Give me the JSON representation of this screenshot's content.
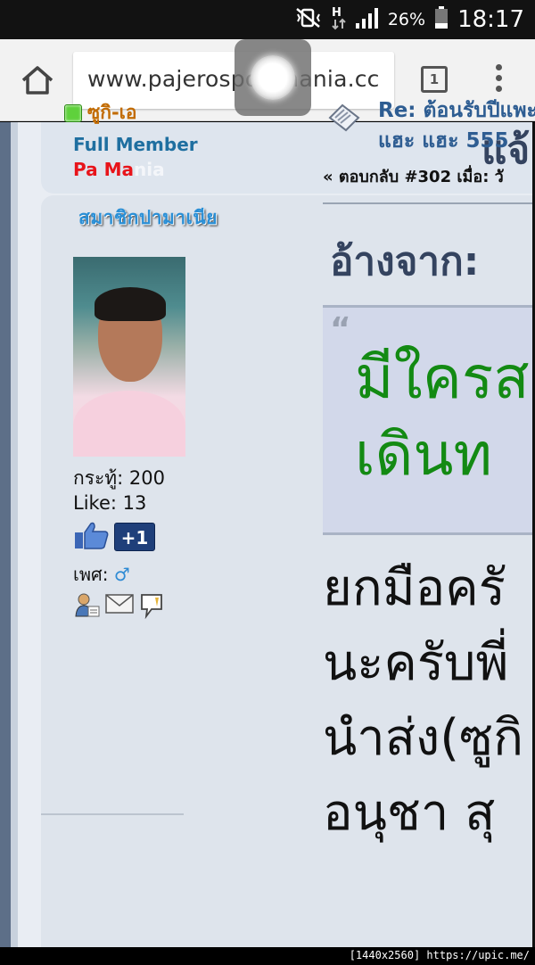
{
  "status_bar": {
    "battery": "26%",
    "time": "18:17",
    "network": "H"
  },
  "browser": {
    "url": "www.pajerosportmania.cc",
    "tab_count": "1"
  },
  "page": {
    "prev_post_fragment": "แจ้",
    "poster": {
      "name": "ซูกิ-เอ",
      "rank": "Full Member",
      "group_visible": "Pa Ma",
      "group_faded": "nia",
      "member_badge": "สมาชิกปามาเนีย",
      "posts_line": "กระทู้: 200",
      "likes_line": "Like: 13",
      "plus_one": "+1",
      "gender_label": "เพศ:",
      "gender_symbol": "♂"
    },
    "post": {
      "subject_line1": "Re: ต้อนรับปีแพะ",
      "subject_line2": "แฮะ แฮะ 555",
      "reply_line": "« ตอบกลับ #302 เมื่อ: วั",
      "quote_header": "อ้างจาก: ",
      "quote_mark": "“",
      "quote_line1": "มีใครส",
      "quote_line2": "เดินท",
      "body_line1": "ยกมือครั",
      "body_line2": "นะครับพี่",
      "body_line3": "นำส่ง(ซูกิ",
      "body_line4": "อนุชา สุ"
    }
  },
  "watermark": "[1440x2560] https://upic.me/"
}
